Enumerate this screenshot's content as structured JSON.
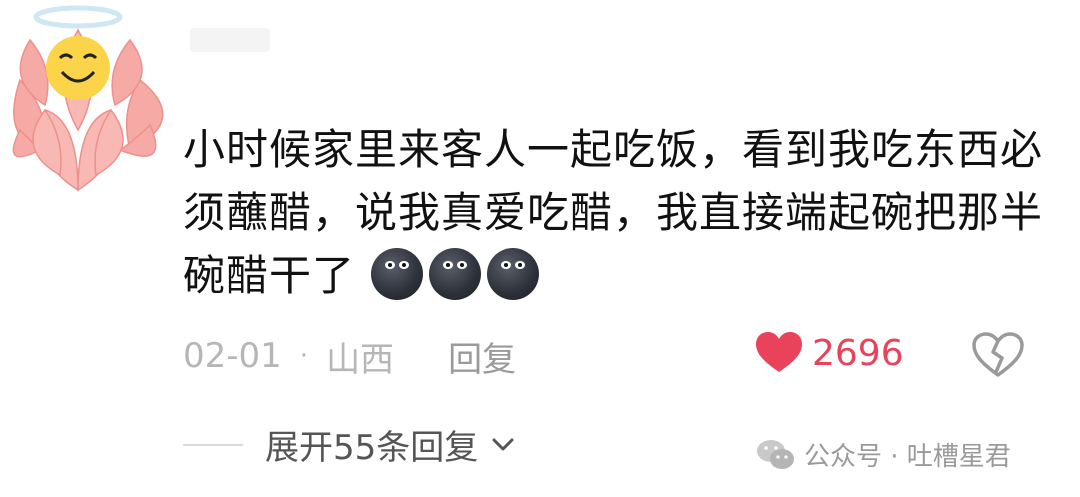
{
  "comment": {
    "avatar_icon": "halo-lotus-smiley-avatar",
    "text": "小时候家里来客人一起吃饭，看到我吃东西必须蘸醋，说我真爱吃醋，我直接端起碗把那半碗醋干了",
    "emojis": [
      "dark-face-emoji",
      "dark-face-emoji",
      "dark-face-emoji"
    ]
  },
  "meta": {
    "date": "02-01",
    "separator": "·",
    "location": "山西",
    "reply_label": "回复"
  },
  "actions": {
    "like_count": "2696",
    "like_color": "#e9435b",
    "like_icon": "heart-icon",
    "dislike_icon": "broken-heart-icon"
  },
  "expand": {
    "label": "展开55条回复",
    "icon": "chevron-down-icon"
  },
  "watermark": {
    "icon": "wechat-icon",
    "text": "公众号 · 吐槽星君"
  }
}
